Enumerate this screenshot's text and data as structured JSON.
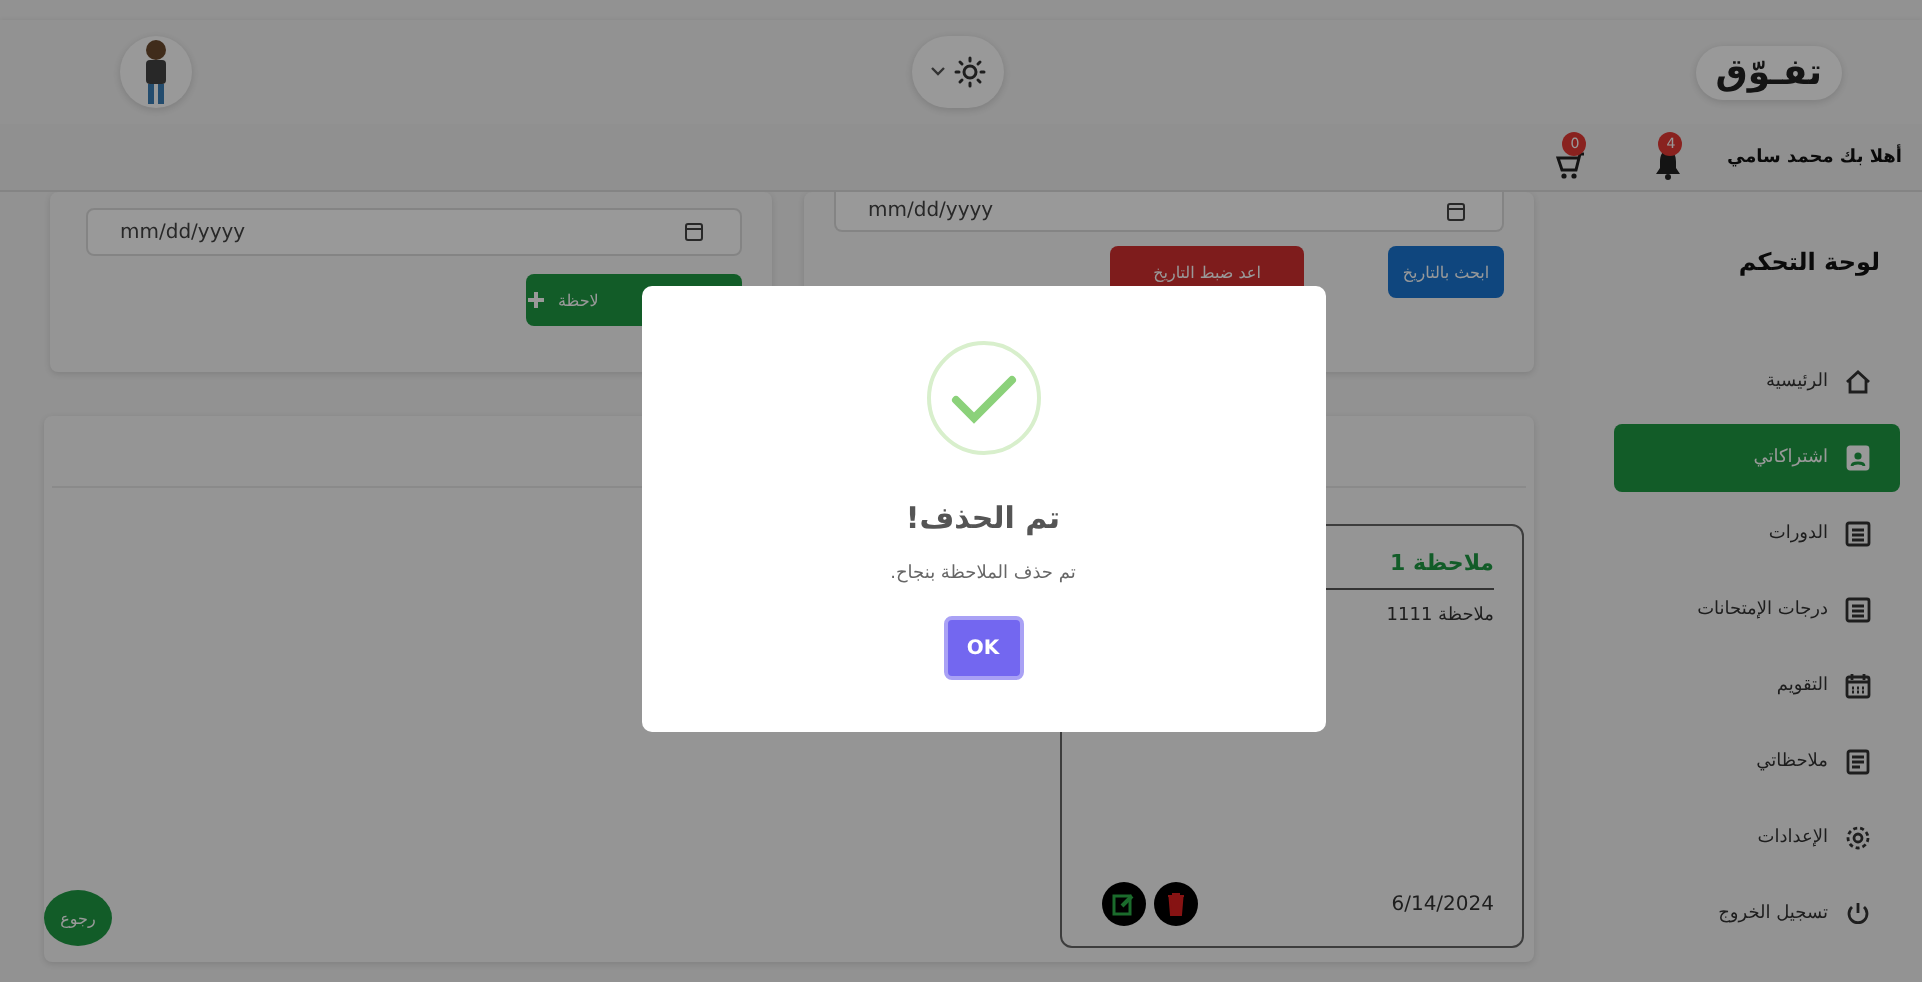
{
  "header": {
    "logo": "تفـوّق",
    "greeting": "أهلا بك محمد سامي",
    "notifications_count": "4",
    "cart_count": "0"
  },
  "sidebar": {
    "title": "لوحة التحكم",
    "items": [
      {
        "label": "الرئيسية",
        "kind": "home",
        "selected": false
      },
      {
        "label": "اشتراكاتي",
        "kind": "badge",
        "selected": true
      },
      {
        "label": "الدورات",
        "kind": "list",
        "selected": false
      },
      {
        "label": "درجات الإمتحانات",
        "kind": "list",
        "selected": false
      },
      {
        "label": "التقويم",
        "kind": "calendar",
        "selected": false
      },
      {
        "label": "ملاحظاتي",
        "kind": "note",
        "selected": false
      },
      {
        "label": "الإعدادات",
        "kind": "gear",
        "selected": false
      },
      {
        "label": "تسجيل الخروج",
        "kind": "power",
        "selected": false
      }
    ]
  },
  "add_panel": {
    "date_placeholder": "mm/dd/yyyy",
    "add_button": "لاحظة"
  },
  "search_panel": {
    "date_placeholder": "mm/dd/yyyy",
    "search_button": "ابحث بالتاريخ",
    "reset_button": "اعد ضبط التاريخ"
  },
  "notes": [
    {
      "title": "ملاحظة 1",
      "body": "ملاحظة 1111",
      "date": "6/14/2024"
    }
  ],
  "back_button": "رجوع",
  "dialog": {
    "kind": "success",
    "title": "تم الحذف!",
    "message": "تم حذف الملاحظة بنجاح.",
    "confirm_button": "OK"
  }
}
